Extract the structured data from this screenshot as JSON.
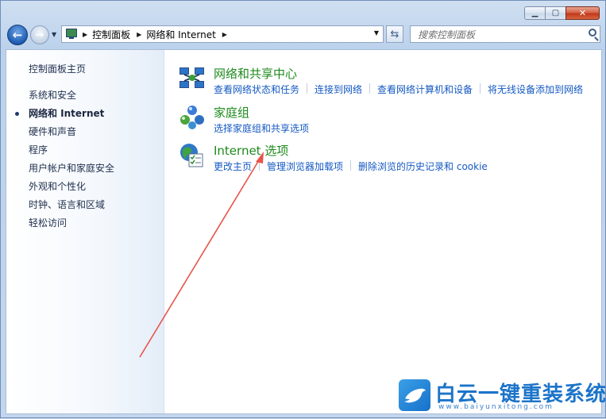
{
  "nav": {
    "breadcrumb": [
      "控制面板",
      "网络和 Internet"
    ],
    "search_placeholder": "搜索控制面板"
  },
  "sidebar": {
    "home": "控制面板主页",
    "items": [
      {
        "label": "系统和安全",
        "active": false
      },
      {
        "label": "网络和 Internet",
        "active": true
      },
      {
        "label": "硬件和声音",
        "active": false
      },
      {
        "label": "程序",
        "active": false
      },
      {
        "label": "用户帐户和家庭安全",
        "active": false
      },
      {
        "label": "外观和个性化",
        "active": false
      },
      {
        "label": "时钟、语言和区域",
        "active": false
      },
      {
        "label": "轻松访问",
        "active": false
      }
    ]
  },
  "categories": [
    {
      "title": "网络和共享中心",
      "icon": "network-sharing-center-icon",
      "links": [
        "查看网络状态和任务",
        "连接到网络",
        "查看网络计算机和设备",
        "将无线设备添加到网络"
      ]
    },
    {
      "title": "家庭组",
      "icon": "homegroup-icon",
      "links": [
        "选择家庭组和共享选项"
      ]
    },
    {
      "title": "Internet 选项",
      "icon": "internet-options-icon",
      "links": [
        "更改主页",
        "管理浏览器加载项",
        "删除浏览的历史记录和 cookie"
      ]
    }
  ],
  "watermark": {
    "text": "白云一键重装系统",
    "sub": "www.baiyunxitong.com"
  },
  "colors": {
    "category_title": "#1d8a1d",
    "link": "#1559c2",
    "annotation_arrow": "#e8534a"
  }
}
